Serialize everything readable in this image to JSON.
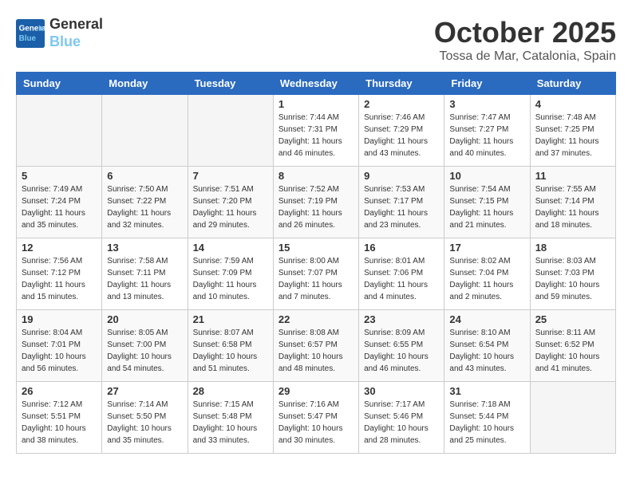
{
  "header": {
    "logo_line1": "General",
    "logo_line2": "Blue",
    "month": "October 2025",
    "location": "Tossa de Mar, Catalonia, Spain"
  },
  "weekdays": [
    "Sunday",
    "Monday",
    "Tuesday",
    "Wednesday",
    "Thursday",
    "Friday",
    "Saturday"
  ],
  "weeks": [
    [
      {
        "day": "",
        "info": ""
      },
      {
        "day": "",
        "info": ""
      },
      {
        "day": "",
        "info": ""
      },
      {
        "day": "1",
        "info": "Sunrise: 7:44 AM\nSunset: 7:31 PM\nDaylight: 11 hours and 46 minutes."
      },
      {
        "day": "2",
        "info": "Sunrise: 7:46 AM\nSunset: 7:29 PM\nDaylight: 11 hours and 43 minutes."
      },
      {
        "day": "3",
        "info": "Sunrise: 7:47 AM\nSunset: 7:27 PM\nDaylight: 11 hours and 40 minutes."
      },
      {
        "day": "4",
        "info": "Sunrise: 7:48 AM\nSunset: 7:25 PM\nDaylight: 11 hours and 37 minutes."
      }
    ],
    [
      {
        "day": "5",
        "info": "Sunrise: 7:49 AM\nSunset: 7:24 PM\nDaylight: 11 hours and 35 minutes."
      },
      {
        "day": "6",
        "info": "Sunrise: 7:50 AM\nSunset: 7:22 PM\nDaylight: 11 hours and 32 minutes."
      },
      {
        "day": "7",
        "info": "Sunrise: 7:51 AM\nSunset: 7:20 PM\nDaylight: 11 hours and 29 minutes."
      },
      {
        "day": "8",
        "info": "Sunrise: 7:52 AM\nSunset: 7:19 PM\nDaylight: 11 hours and 26 minutes."
      },
      {
        "day": "9",
        "info": "Sunrise: 7:53 AM\nSunset: 7:17 PM\nDaylight: 11 hours and 23 minutes."
      },
      {
        "day": "10",
        "info": "Sunrise: 7:54 AM\nSunset: 7:15 PM\nDaylight: 11 hours and 21 minutes."
      },
      {
        "day": "11",
        "info": "Sunrise: 7:55 AM\nSunset: 7:14 PM\nDaylight: 11 hours and 18 minutes."
      }
    ],
    [
      {
        "day": "12",
        "info": "Sunrise: 7:56 AM\nSunset: 7:12 PM\nDaylight: 11 hours and 15 minutes."
      },
      {
        "day": "13",
        "info": "Sunrise: 7:58 AM\nSunset: 7:11 PM\nDaylight: 11 hours and 13 minutes."
      },
      {
        "day": "14",
        "info": "Sunrise: 7:59 AM\nSunset: 7:09 PM\nDaylight: 11 hours and 10 minutes."
      },
      {
        "day": "15",
        "info": "Sunrise: 8:00 AM\nSunset: 7:07 PM\nDaylight: 11 hours and 7 minutes."
      },
      {
        "day": "16",
        "info": "Sunrise: 8:01 AM\nSunset: 7:06 PM\nDaylight: 11 hours and 4 minutes."
      },
      {
        "day": "17",
        "info": "Sunrise: 8:02 AM\nSunset: 7:04 PM\nDaylight: 11 hours and 2 minutes."
      },
      {
        "day": "18",
        "info": "Sunrise: 8:03 AM\nSunset: 7:03 PM\nDaylight: 10 hours and 59 minutes."
      }
    ],
    [
      {
        "day": "19",
        "info": "Sunrise: 8:04 AM\nSunset: 7:01 PM\nDaylight: 10 hours and 56 minutes."
      },
      {
        "day": "20",
        "info": "Sunrise: 8:05 AM\nSunset: 7:00 PM\nDaylight: 10 hours and 54 minutes."
      },
      {
        "day": "21",
        "info": "Sunrise: 8:07 AM\nSunset: 6:58 PM\nDaylight: 10 hours and 51 minutes."
      },
      {
        "day": "22",
        "info": "Sunrise: 8:08 AM\nSunset: 6:57 PM\nDaylight: 10 hours and 48 minutes."
      },
      {
        "day": "23",
        "info": "Sunrise: 8:09 AM\nSunset: 6:55 PM\nDaylight: 10 hours and 46 minutes."
      },
      {
        "day": "24",
        "info": "Sunrise: 8:10 AM\nSunset: 6:54 PM\nDaylight: 10 hours and 43 minutes."
      },
      {
        "day": "25",
        "info": "Sunrise: 8:11 AM\nSunset: 6:52 PM\nDaylight: 10 hours and 41 minutes."
      }
    ],
    [
      {
        "day": "26",
        "info": "Sunrise: 7:12 AM\nSunset: 5:51 PM\nDaylight: 10 hours and 38 minutes."
      },
      {
        "day": "27",
        "info": "Sunrise: 7:14 AM\nSunset: 5:50 PM\nDaylight: 10 hours and 35 minutes."
      },
      {
        "day": "28",
        "info": "Sunrise: 7:15 AM\nSunset: 5:48 PM\nDaylight: 10 hours and 33 minutes."
      },
      {
        "day": "29",
        "info": "Sunrise: 7:16 AM\nSunset: 5:47 PM\nDaylight: 10 hours and 30 minutes."
      },
      {
        "day": "30",
        "info": "Sunrise: 7:17 AM\nSunset: 5:46 PM\nDaylight: 10 hours and 28 minutes."
      },
      {
        "day": "31",
        "info": "Sunrise: 7:18 AM\nSunset: 5:44 PM\nDaylight: 10 hours and 25 minutes."
      },
      {
        "day": "",
        "info": ""
      }
    ]
  ]
}
